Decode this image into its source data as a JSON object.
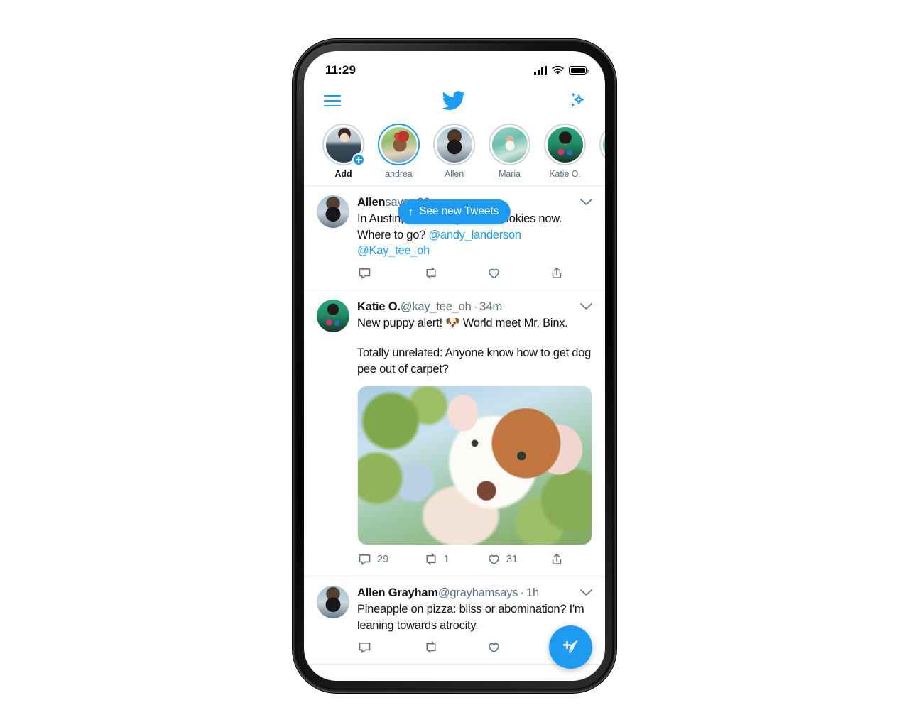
{
  "status_bar": {
    "time": "11:29",
    "signal_icon": "cellular-signal-icon",
    "wifi_icon": "wifi-icon",
    "battery_icon": "battery-icon"
  },
  "app_bar": {
    "menu_icon": "hamburger-menu-icon",
    "logo_icon": "twitter-bird-icon",
    "sparkle_icon": "sparkle-icon"
  },
  "stories": [
    {
      "label": "Add",
      "avatar": "ph-add",
      "active": false,
      "add": true
    },
    {
      "label": "andrea",
      "avatar": "ph-andrea",
      "active": true,
      "add": false
    },
    {
      "label": "Allen",
      "avatar": "ph-allen",
      "active": false,
      "add": false
    },
    {
      "label": "Maria",
      "avatar": "ph-maria",
      "active": false,
      "add": false
    },
    {
      "label": "Katie O.",
      "avatar": "ph-katie",
      "active": false,
      "add": false
    }
  ],
  "new_tweets_pill": {
    "label": "See new Tweets",
    "arrow": "↑"
  },
  "tweets": [
    {
      "name": "Allen",
      "handle": "says",
      "separator": "·",
      "time": "26m",
      "text_line1": "In Austin, need Deep Fried Cookies now.",
      "text_line2_pre": "Where to go? ",
      "mention1": "@andy_landerson",
      "mention2": "@Kay_tee_oh",
      "reply_count": "",
      "retweet_count": "",
      "like_count": ""
    },
    {
      "name": "Katie O.",
      "handle": "@kay_tee_oh",
      "separator": "·",
      "time": "34m",
      "text_p1": "New puppy alert! 🐶 World meet Mr. Binx.",
      "text_p2": "Totally unrelated: Anyone know how to get dog pee out of carpet?",
      "media_alt": "puppy-photo",
      "reply_count": "29",
      "retweet_count": "1",
      "like_count": "31"
    },
    {
      "name": "Allen Grayham",
      "handle": "@grayhamsays",
      "separator": "·",
      "time": "1h",
      "text_p1": "Pineapple on pizza: bliss or abomination? I'm leaning towards atrocity.",
      "reply_count": "",
      "retweet_count": "",
      "like_count": ""
    }
  ],
  "compose_fab": {
    "icon": "compose-feather-icon"
  },
  "colors": {
    "accent": "#1d9bf0",
    "text": "#0f1419",
    "muted": "#5b7083",
    "divider": "#e6ecf0"
  }
}
